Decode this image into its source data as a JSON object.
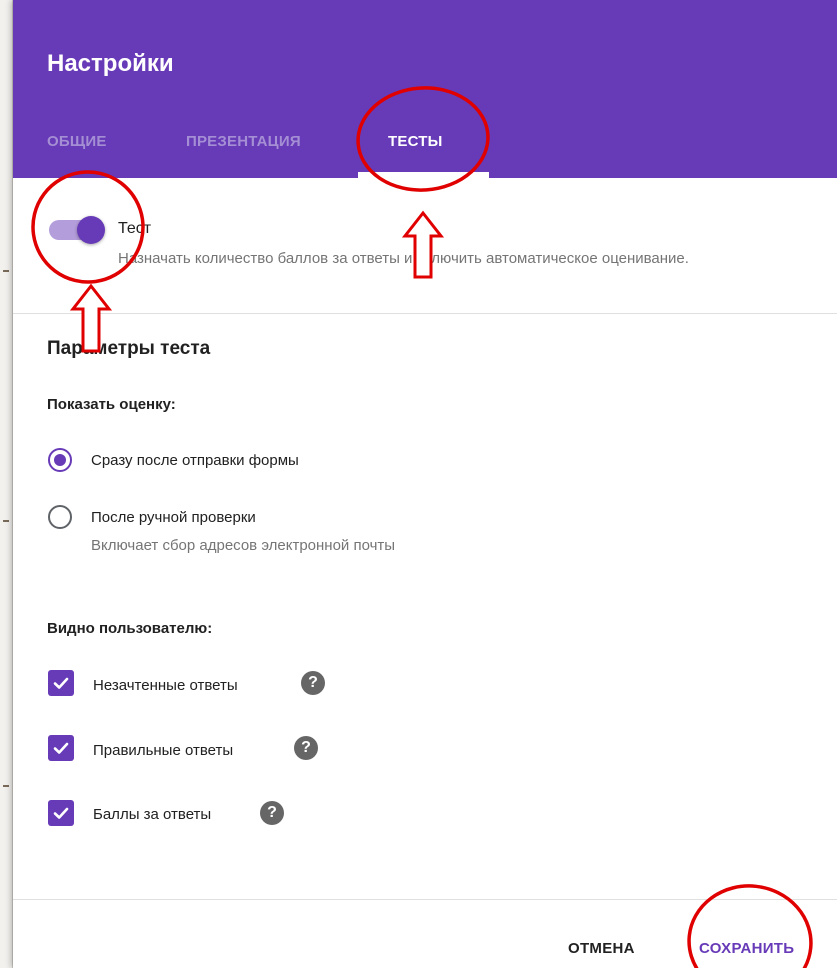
{
  "dialog": {
    "title": "Настройки",
    "tabs": [
      {
        "label": "ОБЩИЕ",
        "active": false
      },
      {
        "label": "ПРЕЗЕНТАЦИЯ",
        "active": false
      },
      {
        "label": "ТЕСТЫ",
        "active": true
      }
    ]
  },
  "quiz_toggle": {
    "enabled": true,
    "title": "Тест",
    "description": "Назначать количество баллов за ответы и включить автоматическое оценивание."
  },
  "quiz_options": {
    "section_title": "Параметры теста",
    "release_grade": {
      "label": "Показать оценку:",
      "options": [
        {
          "label": "Сразу после отправки формы",
          "selected": true,
          "description": ""
        },
        {
          "label": "После ручной проверки",
          "selected": false,
          "description": "Включает сбор адресов электронной почты"
        }
      ]
    },
    "respondent_can_see": {
      "label": "Видно пользователю:",
      "items": [
        {
          "label": "Незачтенные ответы",
          "checked": true
        },
        {
          "label": "Правильные ответы",
          "checked": true
        },
        {
          "label": "Баллы за ответы",
          "checked": true
        }
      ]
    }
  },
  "footer": {
    "cancel_label": "ОТМЕНА",
    "save_label": "СОХРАНИТЬ"
  },
  "icons": {
    "help": "?"
  },
  "colors": {
    "accent": "#673ab7",
    "accent_light": "#b39ddb",
    "header_bg": "#673ab7",
    "annotation": "#e00000"
  }
}
